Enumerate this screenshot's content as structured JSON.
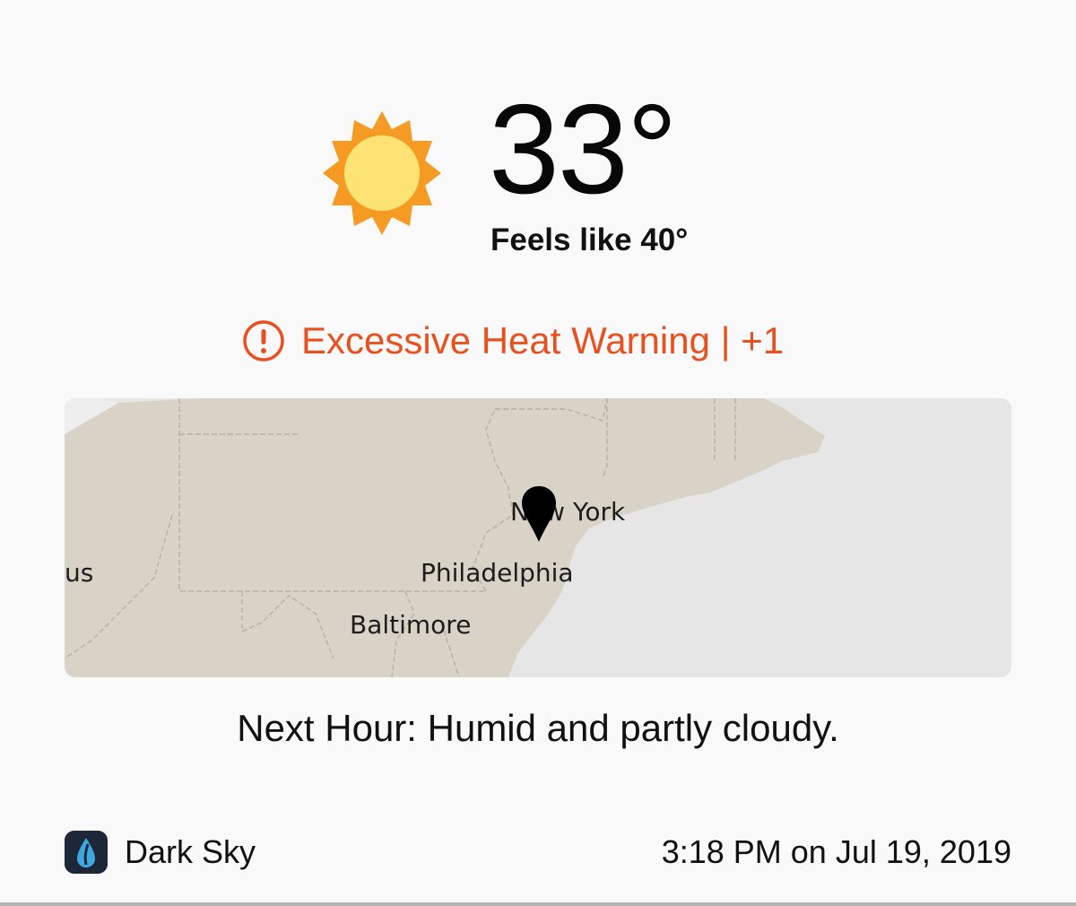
{
  "weather": {
    "condition_icon": "sun-icon",
    "temperature": "33°",
    "feels_like": "Feels like 40°"
  },
  "alert": {
    "icon": "exclamation-circle-icon",
    "text": "Excessive Heat Warning | +1",
    "color": "#e8501f"
  },
  "map": {
    "land_color": "#d9d3c7",
    "water_color": "#e6e6e6",
    "cities": {
      "new_york": "New York",
      "philadelphia": "Philadelphia",
      "baltimore": "Baltimore",
      "columbus_partial": "us"
    },
    "marker_icon": "location-pin-icon"
  },
  "forecast": {
    "next_hour": "Next Hour: Humid and partly cloudy."
  },
  "footer": {
    "app_icon": "dark-sky-app-icon",
    "app_name": "Dark Sky",
    "timestamp": "3:18 PM on Jul 19, 2019"
  }
}
